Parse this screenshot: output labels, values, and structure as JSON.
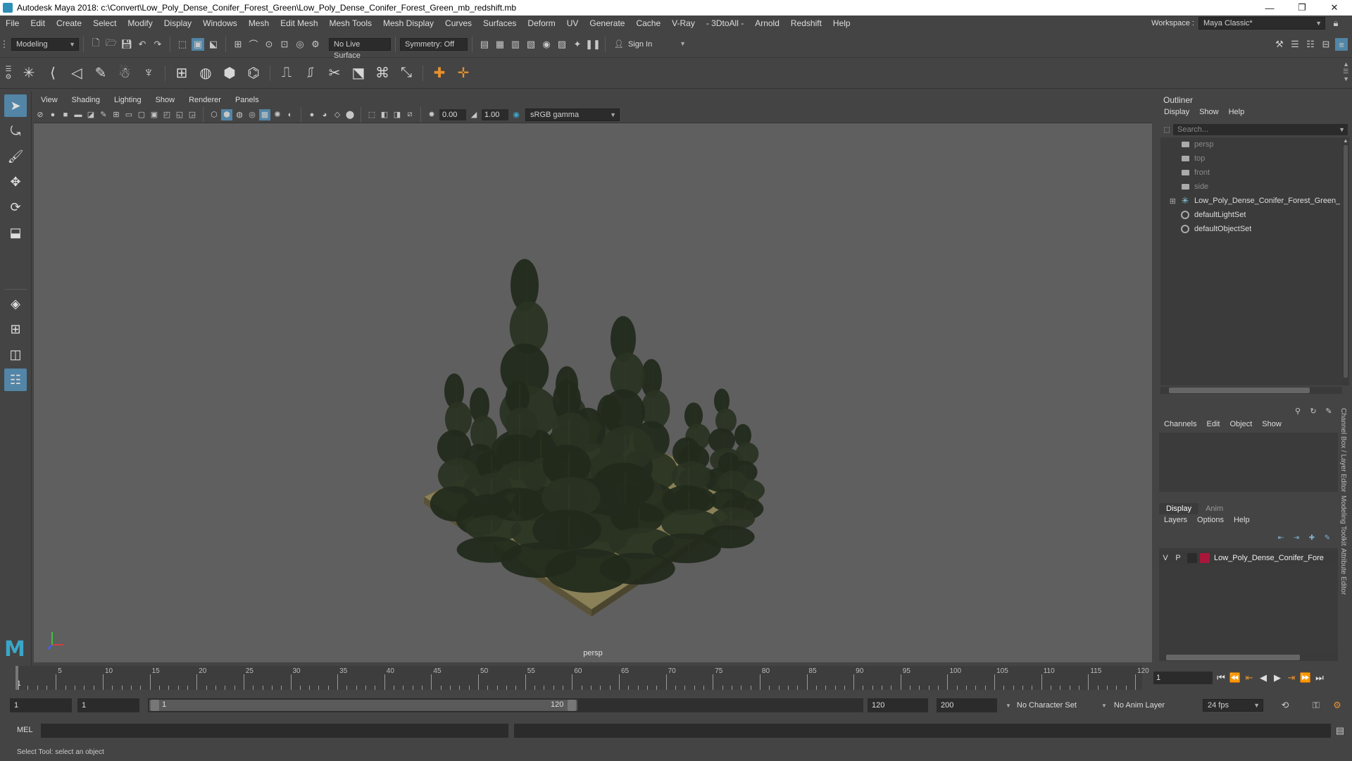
{
  "title": "Autodesk Maya 2018: c:\\Convert\\Low_Poly_Dense_Conifer_Forest_Green\\Low_Poly_Dense_Conifer_Forest_Green_mb_redshift.mb",
  "window_controls": {
    "minimize": "—",
    "restore": "❐",
    "close": "✕"
  },
  "menu": [
    "File",
    "Edit",
    "Create",
    "Select",
    "Modify",
    "Display",
    "Windows",
    "Mesh",
    "Edit Mesh",
    "Mesh Tools",
    "Mesh Display",
    "Curves",
    "Surfaces",
    "Deform",
    "UV",
    "Generate",
    "Cache",
    "V-Ray",
    "- 3DtoAll -",
    "Arnold",
    "Redshift",
    "Help"
  ],
  "workspace": {
    "label": "Workspace :",
    "value": "Maya Classic*"
  },
  "statusline": {
    "mode": "Modeling",
    "live_surface": "No Live Surface",
    "symmetry": "Symmetry: Off",
    "sign_in": "Sign In"
  },
  "viewport": {
    "menu": [
      "View",
      "Shading",
      "Lighting",
      "Show",
      "Renderer",
      "Panels"
    ],
    "exposure": "0.00",
    "gamma": "1.00",
    "colorspace": "sRGB gamma",
    "camera_label": "persp",
    "colors": {
      "background": "#5f5f5f",
      "ground": "#8a8158",
      "foliage": "#2a3323"
    }
  },
  "outliner": {
    "title": "Outliner",
    "menu": [
      "Display",
      "Show",
      "Help"
    ],
    "search_placeholder": "Search...",
    "items": [
      {
        "label": "persp",
        "icon": "camera-icon",
        "dim": true
      },
      {
        "label": "top",
        "icon": "camera-icon",
        "dim": true
      },
      {
        "label": "front",
        "icon": "camera-icon",
        "dim": true
      },
      {
        "label": "side",
        "icon": "camera-icon",
        "dim": true
      },
      {
        "label": "Low_Poly_Dense_Conifer_Forest_Green_",
        "icon": "group-icon",
        "dim": false,
        "expandable": true
      },
      {
        "label": "defaultLightSet",
        "icon": "set-icon",
        "dim": false
      },
      {
        "label": "defaultObjectSet",
        "icon": "set-icon",
        "dim": false
      }
    ]
  },
  "channelbox": {
    "menu": [
      "Channels",
      "Edit",
      "Object",
      "Show"
    ]
  },
  "layers": {
    "tabs": [
      "Display",
      "Anim"
    ],
    "menu": [
      "Layers",
      "Options",
      "Help"
    ],
    "rows": [
      {
        "v": "V",
        "p": "P",
        "name": "Low_Poly_Dense_Conifer_Fore",
        "color": "#a8173a"
      }
    ]
  },
  "side_tabs": [
    "Channel Box / Layer Editor",
    "Modeling Toolkit",
    "Attribute Editor"
  ],
  "timeline": {
    "labels": [
      "5",
      "10",
      "15",
      "20",
      "25",
      "30",
      "35",
      "40",
      "45",
      "50",
      "55",
      "60",
      "65",
      "70",
      "75",
      "80",
      "85",
      "90",
      "95",
      "100",
      "105",
      "110",
      "115",
      "120"
    ],
    "start_frame_label": "1",
    "current_frame": "1"
  },
  "range": {
    "start": "1",
    "playback_start": "1",
    "slider_start": "1",
    "slider_end": "120",
    "playback_end": "120",
    "end": "200",
    "character_set": "No Character Set",
    "anim_layer": "No Anim Layer",
    "fps": "24 fps"
  },
  "cmd": {
    "label": "MEL"
  },
  "help_line": "Select Tool: select an object"
}
